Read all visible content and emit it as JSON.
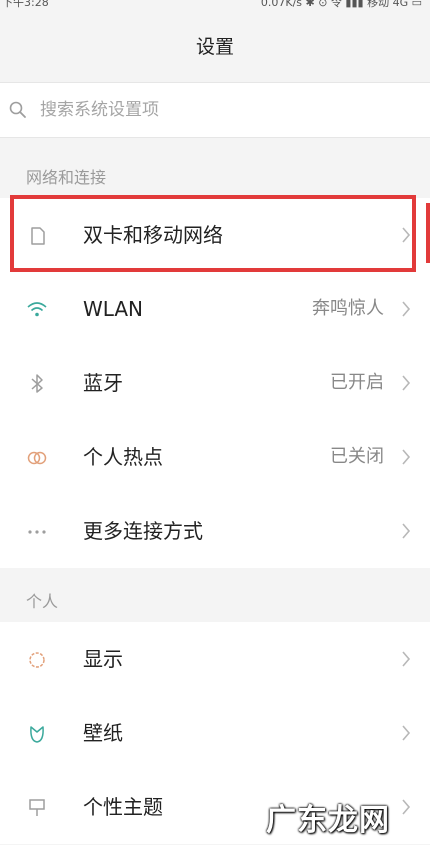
{
  "status_bar": {
    "time": "下午3:28",
    "right": "0.07K/s ✱ ⊙ 令 ▮▮▮ 移动 4G ▭"
  },
  "title": "设置",
  "search": {
    "placeholder": "搜索系统设置项"
  },
  "sections": [
    {
      "header": "网络和连接",
      "items": [
        {
          "icon": "sim-card-icon",
          "label": "双卡和移动网络",
          "value": ""
        },
        {
          "icon": "wifi-icon",
          "label": "WLAN",
          "value": "奔鸣惊人"
        },
        {
          "icon": "bluetooth-icon",
          "label": "蓝牙",
          "value": "已开启"
        },
        {
          "icon": "hotspot-icon",
          "label": "个人热点",
          "value": "已关闭"
        },
        {
          "icon": "more-icon",
          "label": "更多连接方式",
          "value": ""
        }
      ]
    },
    {
      "header": "个人",
      "items": [
        {
          "icon": "display-icon",
          "label": "显示",
          "value": ""
        },
        {
          "icon": "wallpaper-icon",
          "label": "壁纸",
          "value": ""
        },
        {
          "icon": "theme-icon",
          "label": "个性主题",
          "value": ""
        }
      ]
    }
  ],
  "watermark": "广东龙网",
  "colors": {
    "highlight": "#e23a3a",
    "icon": "#9e9e9e",
    "accent": "#3ba99c"
  }
}
